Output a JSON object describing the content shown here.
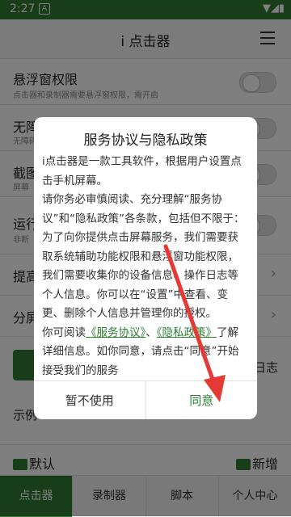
{
  "status": {
    "time": "2:27",
    "notif": "A",
    "icons": "▼◢▮"
  },
  "appbar": {
    "title": "i 点击器",
    "menu_icon": "menu-icon"
  },
  "settings": [
    {
      "title": "悬浮窗权限",
      "sub": "点击器和录制器需要悬浮窗权限，需开启"
    },
    {
      "title": "无障",
      "sub": "无障碍"
    },
    {
      "title": "截图",
      "sub": "屏幕"
    },
    {
      "title": "运行",
      "sub": "非断"
    },
    {
      "title": "提高"
    },
    {
      "title": "分屏"
    }
  ],
  "log_label": "日志",
  "sample_label": "示例",
  "folders": {
    "default": "默认",
    "new": "新增"
  },
  "tabs": [
    "点击器",
    "录制器",
    "脚本",
    "个人中心"
  ],
  "dialog": {
    "title": "服务协议与隐私政策",
    "p1": "i点击器是一款工具软件，根据用户设置点击手机屏幕。",
    "p2": "请你务必审慎阅读、充分理解“服务协议”和“隐私政策”各条款，包括但不限于：为了向你提供点击屏幕服务，我们需要获取系统辅助功能权限和悬浮窗功能权限，我们需要收集你的设备信息、操作日志等个人信息。你可以在“设置”中查看、变更、删除个人信息并管理你的授权。",
    "p3_pre": "你可阅读",
    "link_service": "《服务协议》",
    "sep": "、",
    "link_privacy": "《隐私政策》",
    "p3_post": "了解详细信息。如你同意，请点击“同意”开始接受我们的服务",
    "btn_decline": "暂不使用",
    "btn_agree": "同意"
  }
}
